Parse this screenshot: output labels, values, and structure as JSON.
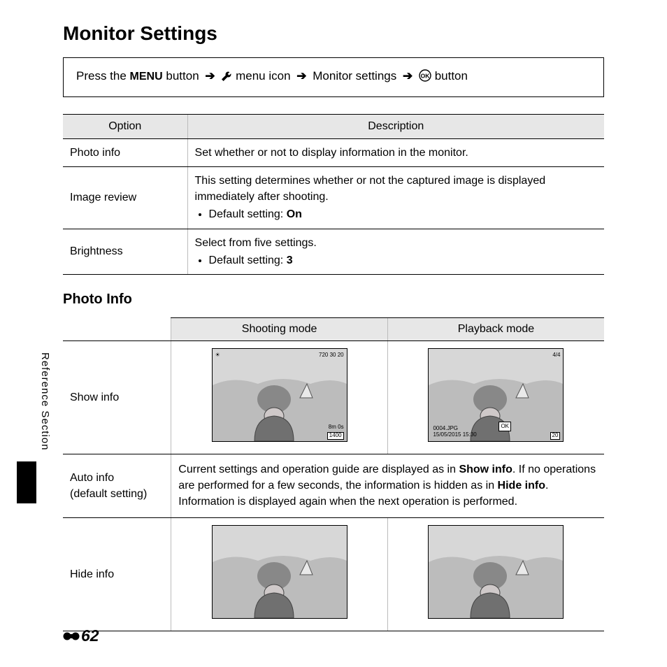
{
  "title": "Monitor Settings",
  "nav": {
    "prefix": "Press the ",
    "menu_label": "MENU",
    "after_menu": " button ",
    "arrow": "➔",
    "after_icon": " menu icon ",
    "monitor": " Monitor settings ",
    "after_ok": " button"
  },
  "opts": {
    "head_option": "Option",
    "head_desc": "Description",
    "rows": [
      {
        "option": "Photo info",
        "desc": "Set whether or not to display information in the monitor."
      },
      {
        "option": "Image review",
        "desc": "This setting determines whether or not the captured image is displayed immediately after shooting.",
        "bullet_prefix": "Default setting: ",
        "bullet_bold": "On"
      },
      {
        "option": "Brightness",
        "desc": "Select from five settings.",
        "bullet_prefix": "Default setting: ",
        "bullet_bold": "3"
      }
    ]
  },
  "photo_info": {
    "heading": "Photo Info",
    "head_shoot": "Shooting mode",
    "head_play": "Playback mode",
    "row1_label": "Show info",
    "row2_label_a": "Auto info",
    "row2_label_b": "(default setting)",
    "row2_text_a": "Current settings and operation guide are displayed as in ",
    "row2_bold_a": "Show info",
    "row2_text_b": ". If no operations are performed for a few seconds, the information is hidden as in ",
    "row2_bold_b": "Hide info",
    "row2_text_c": ". Information is displayed again when the next operation is performed.",
    "row3_label": "Hide info",
    "overlay": {
      "shoot_tl": "☀",
      "shoot_tr": "720 30 20",
      "shoot_br1": "8m 0s",
      "shoot_br2": "1400",
      "play_tr": "4/4",
      "play_bl1": "0004.JPG",
      "play_bl2": "15/05/2015 15:30",
      "play_ok": "OK",
      "play_br": "20"
    }
  },
  "side_label": "Reference Section",
  "page_number": "62"
}
